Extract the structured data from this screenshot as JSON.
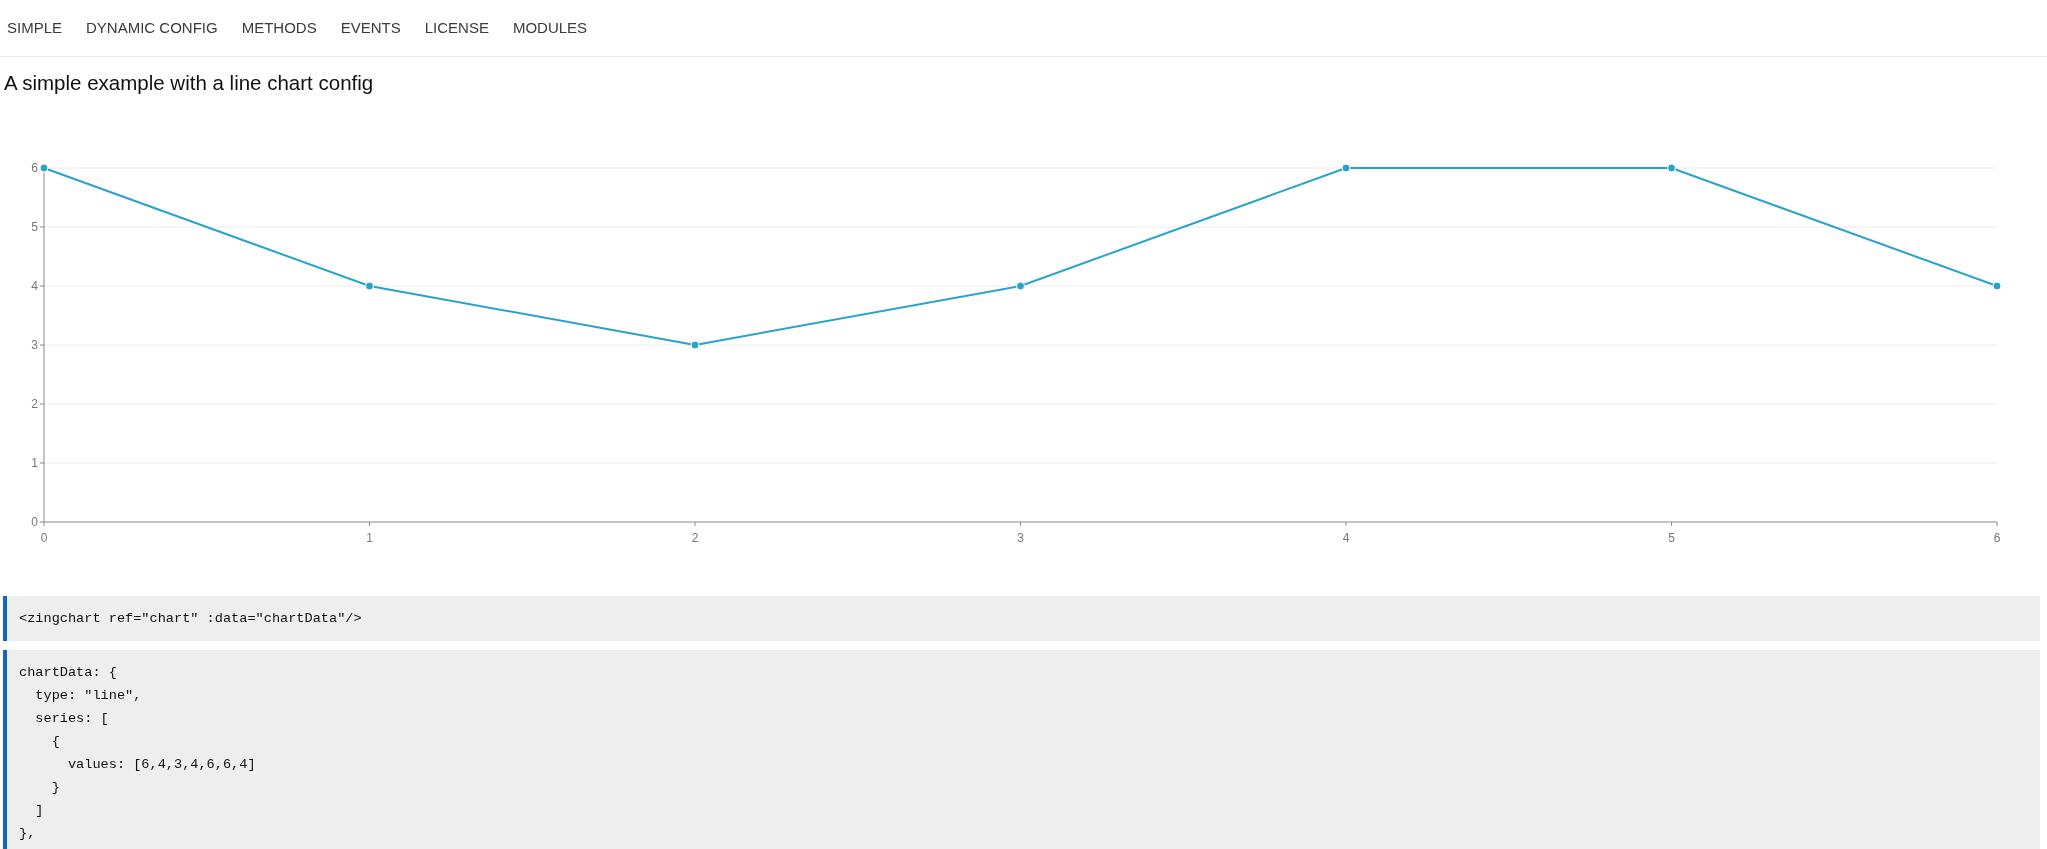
{
  "nav": {
    "items": [
      {
        "label": "SIMPLE"
      },
      {
        "label": "DYNAMIC CONFIG"
      },
      {
        "label": "METHODS"
      },
      {
        "label": "EVENTS"
      },
      {
        "label": "LICENSE"
      },
      {
        "label": "MODULES"
      }
    ]
  },
  "heading": "A simple example with a line chart config",
  "chart": {
    "chart_data": {
      "type": "line",
      "x": [
        0,
        1,
        2,
        3,
        4,
        5,
        6
      ],
      "series": [
        {
          "color": "#29a2cc",
          "marker": true,
          "values": [
            6,
            4,
            3,
            4,
            6,
            6,
            4
          ]
        }
      ],
      "xlim": [
        0,
        6
      ],
      "ylim": [
        0,
        6
      ],
      "xticks": [
        0,
        1,
        2,
        3,
        4,
        5,
        6
      ],
      "yticks": [
        0,
        1,
        2,
        3,
        4,
        5,
        6
      ],
      "grid": true
    }
  },
  "code_blocks": [
    {
      "lines": [
        "<zingchart ref=\"chart\" :data=\"chartData\"/>"
      ]
    },
    {
      "lines": [
        "chartData: {",
        "  type: \"line\",",
        "  series: [",
        "    {",
        "      values: [6,4,3,4,6,6,4]",
        "    }",
        "  ]",
        "},"
      ]
    }
  ]
}
